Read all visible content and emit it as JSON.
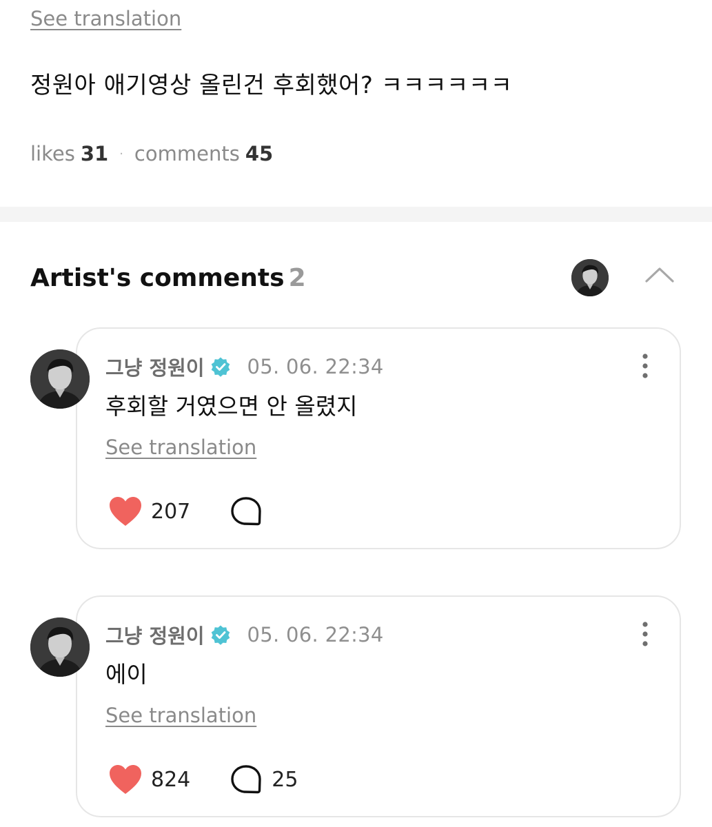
{
  "post": {
    "see_translation": "See translation",
    "text": "정원아 애기영상 올린건 후회했어? ㅋㅋㅋㅋㅋㅋ",
    "likes_label": "likes",
    "likes_count": "31",
    "separator": "·",
    "comments_label": "comments",
    "comments_count": "45"
  },
  "artist_comments": {
    "title": "Artist's comments",
    "count": "2",
    "items": [
      {
        "name": "그냥 정원이",
        "time": "05. 06. 22:34",
        "body": "후회할 거였으면 안 올렸지",
        "see_translation": "See translation",
        "likes": "207",
        "replies": ""
      },
      {
        "name": "그냥 정원이",
        "time": "05. 06. 22:34",
        "body": "에이",
        "see_translation": "See translation",
        "likes": "824",
        "replies": "25"
      }
    ]
  },
  "icons": {
    "verified": "verified-badge-icon",
    "heart": "heart-icon",
    "reply": "speech-bubble-icon",
    "more": "more-vertical-icon",
    "collapse": "chevron-up-icon"
  },
  "colors": {
    "verified_badge": "#4fc3d4",
    "heart": "#f0635e",
    "muted_text": "#8a8a8a",
    "divider": "#f4f4f4",
    "card_border": "#e6e6e6"
  }
}
